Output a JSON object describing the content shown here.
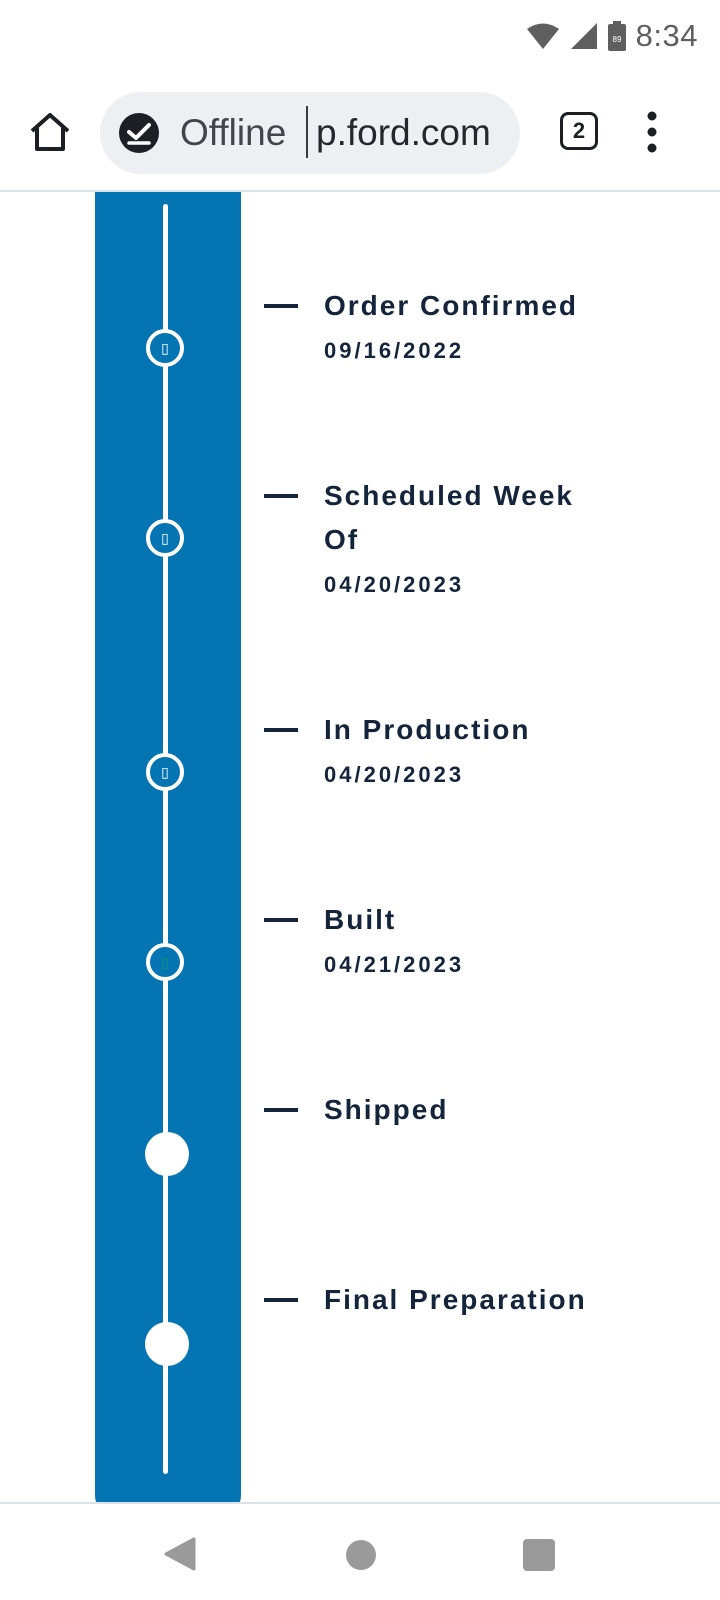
{
  "status_bar": {
    "time": "8:34",
    "battery_level": "89",
    "icons": [
      "wifi-icon",
      "cell-signal-icon",
      "battery-icon"
    ]
  },
  "browser": {
    "offline_label": "Offline",
    "url": "p.ford.com",
    "tab_count": "2",
    "icons": [
      "home-icon",
      "offline-check-icon",
      "tab-switcher-icon",
      "more-menu-icon"
    ]
  },
  "timeline": {
    "colors": {
      "panel": "#0474b2",
      "text": "#14243a",
      "node": "#ffffff"
    },
    "steps": [
      {
        "title": "Order Confirmed",
        "date": "09/16/2022",
        "completed": true
      },
      {
        "title": "Scheduled Week Of",
        "date": "04/20/2023",
        "completed": true
      },
      {
        "title": "In Production",
        "date": "04/20/2023",
        "completed": true
      },
      {
        "title": "Built",
        "date": "04/21/2023",
        "completed": true
      },
      {
        "title": "Shipped",
        "date": "",
        "completed": false
      },
      {
        "title": "Final Preparation",
        "date": "",
        "completed": false
      }
    ]
  },
  "nav_bar": {
    "icons": [
      "back-icon",
      "home-circle-icon",
      "recents-icon"
    ]
  }
}
